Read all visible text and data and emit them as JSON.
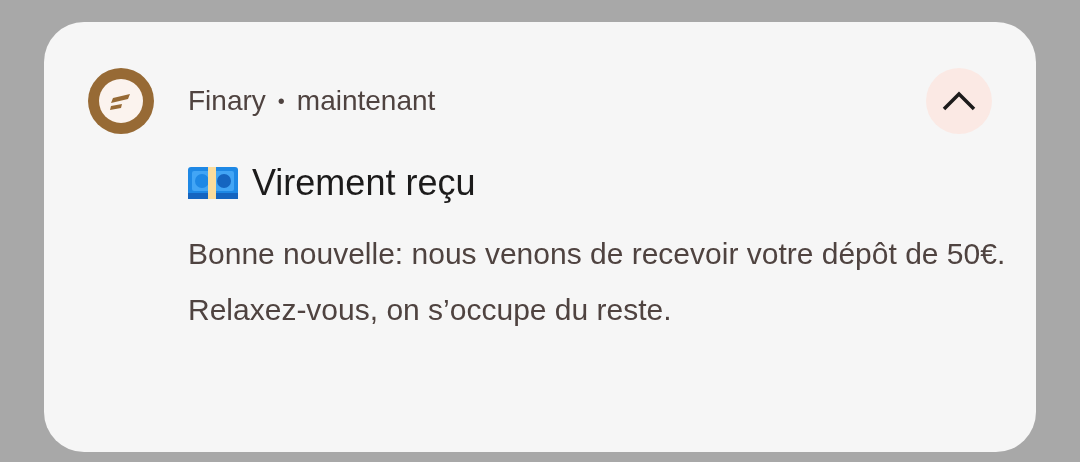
{
  "notification": {
    "app_name": "Finary",
    "separator": "•",
    "time": "maintenant",
    "expanded": true,
    "title": "Virement reçu",
    "body": "Bonne nouvelle: nous venons de recevoir votre dépôt de 50€. Relaxez-vous, on s’occupe du reste."
  }
}
